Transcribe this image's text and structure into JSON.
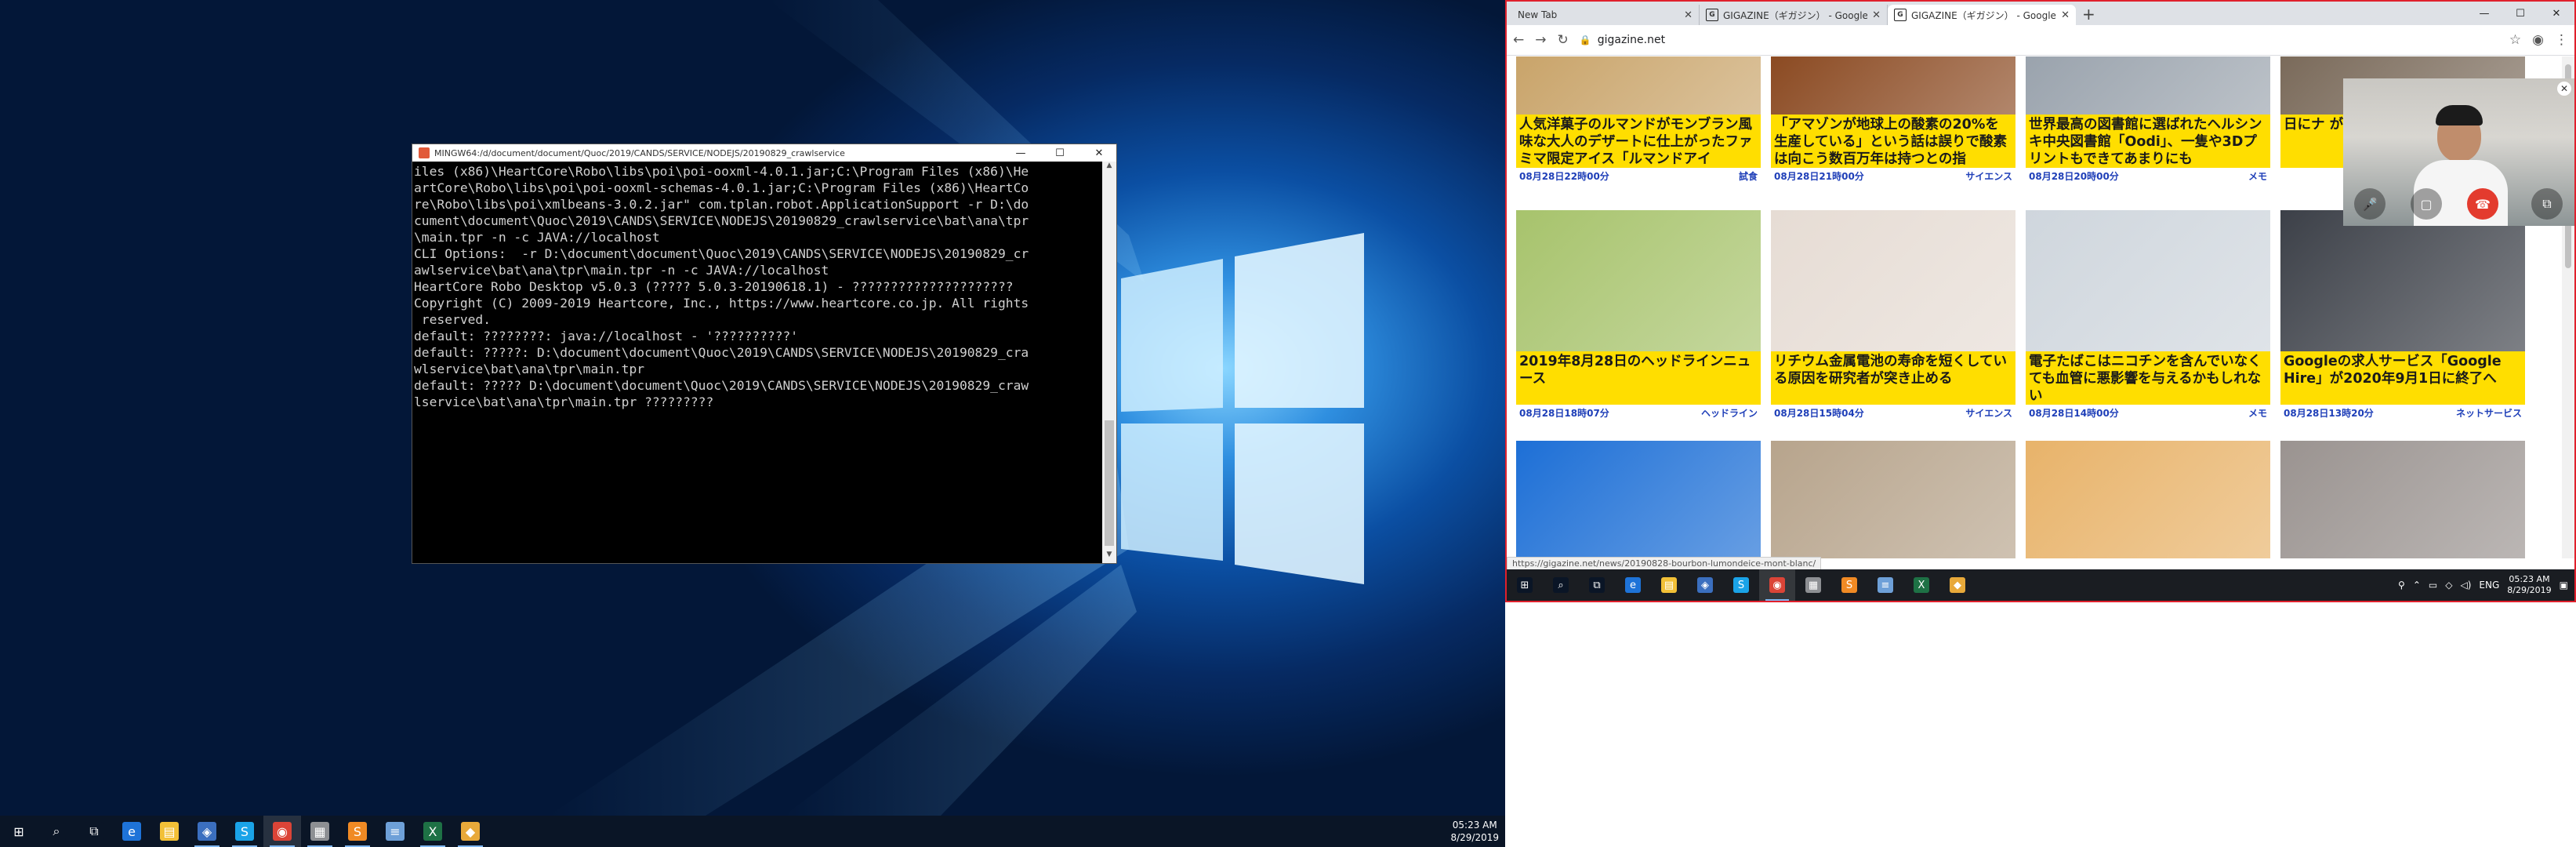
{
  "terminal": {
    "title": "MINGW64:/d/document/document/Quoc/2019/CANDS/SERVICE/NODEJS/20190829_crawlservice",
    "controls": {
      "minimize": "—",
      "maximize": "☐",
      "close": "✕"
    },
    "lines": [
      "iles (x86)\\HeartCore\\Robo\\libs\\poi\\poi-ooxml-4.0.1.jar;C:\\Program Files (x86)\\He",
      "artCore\\Robo\\libs\\poi\\poi-ooxml-schemas-4.0.1.jar;C:\\Program Files (x86)\\HeartCo",
      "re\\Robo\\libs\\poi\\xmlbeans-3.0.2.jar\" com.tplan.robot.ApplicationSupport -r D:\\do",
      "cument\\document\\Quoc\\2019\\CANDS\\SERVICE\\NODEJS\\20190829_crawlservice\\bat\\ana\\tpr",
      "\\main.tpr -n -c JAVA://localhost",
      "",
      "CLI Options:  -r D:\\document\\document\\Quoc\\2019\\CANDS\\SERVICE\\NODEJS\\20190829_cr",
      "awlservice\\bat\\ana\\tpr\\main.tpr -n -c JAVA://localhost",
      "",
      "",
      "HeartCore Robo Desktop v5.0.3 (????? 5.0.3-20190618.1) - ?????????????????????",
      "Copyright (C) 2009-2019 Heartcore, Inc., https://www.heartcore.co.jp. All rights",
      " reserved.",
      "",
      "",
      "default: ????????: java://localhost - '??????????'",
      "",
      "default: ?????: D:\\document\\document\\Quoc\\2019\\CANDS\\SERVICE\\NODEJS\\20190829_cra",
      "wlservice\\bat\\ana\\tpr\\main.tpr",
      "",
      "default: ????? D:\\document\\document\\Quoc\\2019\\CANDS\\SERVICE\\NODEJS\\20190829_craw",
      "lservice\\bat\\ana\\tpr\\main.tpr ?????????"
    ]
  },
  "left_taskbar": {
    "clock_time": "05:23 AM",
    "clock_date": "8/29/2019",
    "icons": [
      "start-icon",
      "search-icon",
      "task-view-icon",
      "edge-icon",
      "file-explorer-icon",
      "network-app-icon",
      "skype-icon",
      "chrome-icon",
      "files-app-icon",
      "sublime-icon",
      "notepad-icon",
      "excel-icon",
      "git-icon"
    ]
  },
  "browser": {
    "tabs": [
      {
        "title": "New Tab",
        "favicon": ""
      },
      {
        "title": "GIGAZINE（ギガジン） - Google …",
        "favicon": "G"
      },
      {
        "title": "GIGAZINE（ギガジン） - Google …",
        "favicon": "G"
      }
    ],
    "new_tab": "+",
    "window_controls": {
      "minimize": "—",
      "maximize": "☐",
      "close": "✕"
    },
    "url": "gigazine.net",
    "status_url": "https://gigazine.net/news/20190828-bourbon-lumondeice-mont-blanc/"
  },
  "articles": [
    {
      "title": "人気洋菓子のルマンドがモンブラン風味な大人のデザートに仕上がったファミマ限定アイス「ルマンドアイ",
      "date": "08月28日22時00分",
      "category": "試食",
      "img_color": "#c9a46a"
    },
    {
      "title": "「アマゾンが地球上の酸素の20%を生産している」という話は誤りで酸素は向こう数百万年は持つとの指",
      "date": "08月28日21時00分",
      "category": "サイエンス",
      "img_color": "#8b4a22"
    },
    {
      "title": "世界最高の図書館に選ばれたヘルシンキ中央図書館「Oodi」、一隻や3Dプリントもできてあまりにも",
      "date": "08月28日20時00分",
      "category": "メモ",
      "img_color": "#9aa3ad"
    },
    {
      "title": "日にナ が可能に",
      "date": "",
      "category": "",
      "img_color": "#7a6a5a"
    },
    {
      "title": "2019年8月28日のヘッドラインニュース",
      "date": "08月28日18時07分",
      "category": "ヘッドライン",
      "img_color": "#a7c36c"
    },
    {
      "title": "リチウム金属電池の寿命を短くしている原因を研究者が突き止める",
      "date": "08月28日15時04分",
      "category": "サイエンス",
      "img_color": "#e6dcd4"
    },
    {
      "title": "電子たばこはニコチンを含んでいなくても血管に悪影響を与えるかもしれない",
      "date": "08月28日14時00分",
      "category": "メモ",
      "img_color": "#cfd6dd"
    },
    {
      "title": "Googleの求人サービス「Google Hire」が2020年9月1日に終了へ",
      "date": "08月28日13時20分",
      "category": "ネットサービス",
      "img_color": "#3c4048"
    },
    {
      "title": "",
      "date": "",
      "category": "",
      "img_color": "#1d6fd6"
    },
    {
      "title": "",
      "date": "",
      "category": "",
      "img_color": "#b7a48c"
    },
    {
      "title": "",
      "date": "",
      "category": "",
      "img_color": "#e8b36a"
    },
    {
      "title": "",
      "date": "",
      "category": "",
      "img_color": "#9a9390"
    }
  ],
  "video_call": {
    "close": "✕",
    "mic": "🎤",
    "camera": "▢",
    "hangup": "☎",
    "expand": "⧉"
  },
  "right_taskbar": {
    "clock_time": "05:23 AM",
    "clock_date": "8/29/2019",
    "lang": "ENG"
  }
}
